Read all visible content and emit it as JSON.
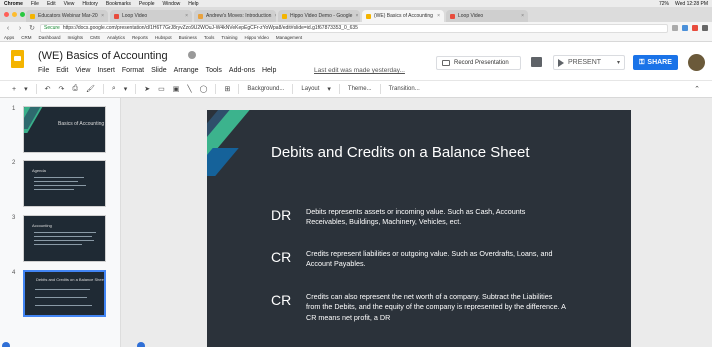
{
  "mac_menubar": {
    "items": [
      "Chrome",
      "File",
      "Edit",
      "View",
      "History",
      "Bookmarks",
      "People",
      "Window",
      "Help"
    ],
    "status": "72%",
    "clock": "Wed 12:28 PM"
  },
  "tabs": [
    {
      "title": "Educators Webinar Mar-20",
      "active": false
    },
    {
      "title": "Loop Video",
      "active": false
    },
    {
      "title": "Andrew's Moves: Introduction",
      "active": false
    },
    {
      "title": "Hippo Video Demo - Google",
      "active": false
    },
    {
      "title": "(WE) Basics of Accounting",
      "active": true
    },
    {
      "title": "Loop Video",
      "active": false
    }
  ],
  "address_bar": {
    "secure_label": "Secure",
    "url": "https://docs.google.com/presentation/d/1H6T7GrJ8ryvZzo9U2WOuJ-W4kNVeKepEgCFr-zYoWpa8/edit#slide=id.g1f67873353_0_635"
  },
  "bookmarks": [
    "Apps",
    "CRM",
    "Dashboard",
    "Insights",
    "CMS",
    "Analytics",
    "Reports",
    "Hubspot",
    "Business",
    "Tools",
    "Training",
    "Hippo Video",
    "Management"
  ],
  "docs": {
    "title": "(WE) Basics of Accounting",
    "menus": [
      "File",
      "Edit",
      "View",
      "Insert",
      "Format",
      "Slide",
      "Arrange",
      "Tools",
      "Add-ons",
      "Help"
    ],
    "last_edit": "Last edit was made yesterday...",
    "record_label": "Record Presentation",
    "present_label": "PRESENT",
    "share_label": "SHARE"
  },
  "toolbar": {
    "background_label": "Background...",
    "layout_label": "Layout",
    "theme_label": "Theme...",
    "transition_label": "Transition..."
  },
  "filmstrip": [
    {
      "number": "1",
      "title": "Basics of Accounting",
      "selected": false
    },
    {
      "number": "2",
      "title": "Agenda",
      "selected": false
    },
    {
      "number": "3",
      "title": "Accounting",
      "selected": false
    },
    {
      "number": "4",
      "title": "Debits and Credits on a Balance Sheet",
      "selected": true
    }
  ],
  "slide": {
    "title": "Debits and Credits on a Balance Sheet",
    "rows": [
      {
        "label": "DR",
        "text": "Debits represents assets or incoming value. Such as  Cash, Accounts Receivables, Buildings, Machinery, Vehicles, ect."
      },
      {
        "label": "CR",
        "text": "Credits represent liabilities or outgoing value. Such as Overdrafts, Loans, and Account Payables."
      },
      {
        "label": "CR",
        "text": "Credits can also represent the net worth of a company. Subtract the Liabilities from the Debits, and the equity of the company is represented by the difference. A CR means net profit, a DR"
      }
    ]
  },
  "colors": {
    "share_blue": "#1a73e8",
    "slide_bg": "#2b323a",
    "accent_green": "#3cb38d",
    "accent_blue": "#15629a",
    "slides_yellow": "#f4b400"
  }
}
